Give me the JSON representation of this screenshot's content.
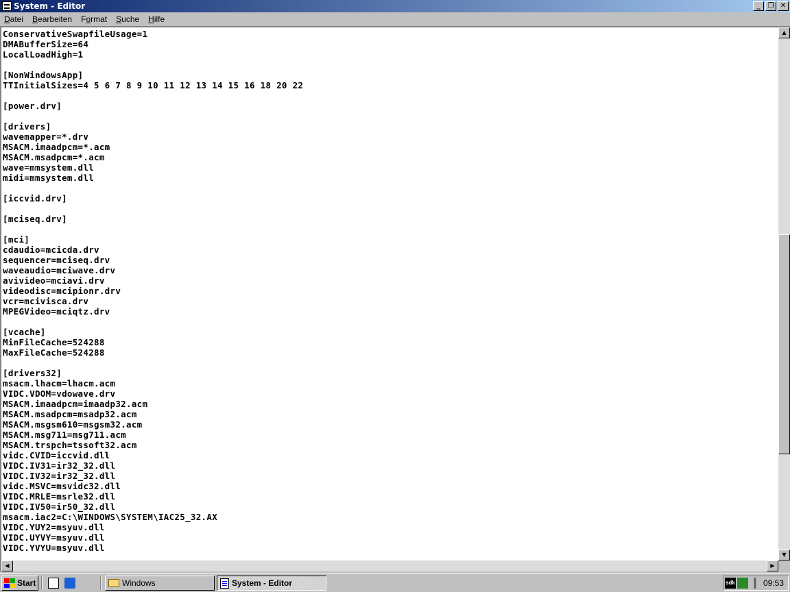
{
  "window": {
    "title": "System - Editor",
    "buttons": {
      "minimize": "_",
      "maximize": "❐",
      "close": "✕"
    }
  },
  "menu": [
    {
      "label": "Datei",
      "accel": "D"
    },
    {
      "label": "Bearbeiten",
      "accel": "B"
    },
    {
      "label": "Format",
      "accel": "o"
    },
    {
      "label": "Suche",
      "accel": "S"
    },
    {
      "label": "Hilfe",
      "accel": "H"
    }
  ],
  "document": {
    "lines": [
      "ConservativeSwapfileUsage=1",
      "DMABufferSize=64",
      "LocalLoadHigh=1",
      "",
      "[NonWindowsApp]",
      "TTInitialSizes=4 5 6 7 8 9 10 11 12 13 14 15 16 18 20 22",
      "",
      "[power.drv]",
      "",
      "[drivers]",
      "wavemapper=*.drv",
      "MSACM.imaadpcm=*.acm",
      "MSACM.msadpcm=*.acm",
      "wave=mmsystem.dll",
      "midi=mmsystem.dll",
      "",
      "[iccvid.drv]",
      "",
      "[mciseq.drv]",
      "",
      "[mci]",
      "cdaudio=mcicda.drv",
      "sequencer=mciseq.drv",
      "waveaudio=mciwave.drv",
      "avivideo=mciavi.drv",
      "videodisc=mcipionr.drv",
      "vcr=mcivisca.drv",
      "MPEGVideo=mciqtz.drv",
      "",
      "[vcache]",
      "MinFileCache=524288",
      "MaxFileCache=524288",
      "",
      "[drivers32]",
      "msacm.lhacm=lhacm.acm",
      "VIDC.VDOM=vdowave.drv",
      "MSACM.imaadpcm=imaadp32.acm",
      "MSACM.msadpcm=msadp32.acm",
      "MSACM.msgsm610=msgsm32.acm",
      "MSACM.msg711=msg711.acm",
      "MSACM.trspch=tssoft32.acm",
      "vidc.CVID=iccvid.dll",
      "VIDC.IV31=ir32_32.dll",
      "VIDC.IV32=ir32_32.dll",
      "vidc.MSVC=msvidc32.dll",
      "VIDC.MRLE=msrle32.dll",
      "VIDC.IV50=ir50_32.dll",
      "msacm.iac2=C:\\WINDOWS\\SYSTEM\\IAC25_32.AX",
      "VIDC.YUY2=msyuv.dll",
      "VIDC.UYVY=msyuv.dll",
      "VIDC.YVYU=msyuv.dll"
    ]
  },
  "scrollbar": {
    "vertical_position": 0.42,
    "vertical_visible_fraction": 0.43
  },
  "taskbar": {
    "start_label": "Start",
    "tasks": [
      {
        "label": "Windows",
        "icon": "folder-icon",
        "active": false
      },
      {
        "label": "System - Editor",
        "icon": "notepad-icon",
        "active": true
      }
    ],
    "tray_icons": [
      "sdk-icon",
      "network-icon",
      "volume-icon"
    ],
    "clock": "09:53"
  }
}
